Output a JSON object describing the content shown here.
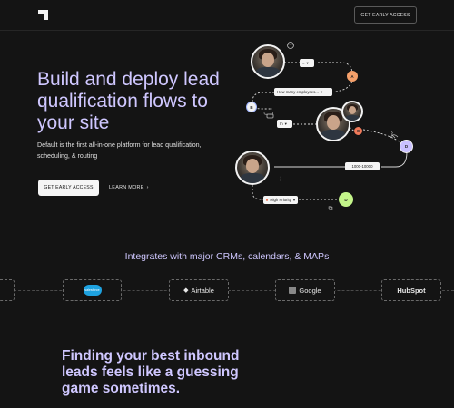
{
  "header": {
    "logo_icon": "default-logo-icon",
    "cta_label": "GET EARLY ACCESS"
  },
  "hero": {
    "title": "Build and deploy lead qualification flows to your site",
    "subtitle": "Default is the first all-in-one platform for lead qualification, scheduling, & routing",
    "primary_button": "GET EARLY ACCESS",
    "secondary_link": "LEARN MORE",
    "secondary_link_icon": "chevron-right-icon"
  },
  "flow": {
    "chip_equals": "= ",
    "chip_question": "How many employees...",
    "chip_in": "In",
    "chip_range": "1000-10000",
    "chip_priority": "High Priority",
    "node_a": "A",
    "node_c": "C",
    "node_d": "D",
    "node_b": "B",
    "accent_orange": "#f5a06a",
    "accent_purple": "#c9c0ff",
    "accent_green": "#c4f58a"
  },
  "integrations": {
    "heading": "Integrates with major CRMs, calendars, & MAPs",
    "logos": [
      "salesforce",
      "Airtable",
      "Google",
      "HubSpot"
    ]
  },
  "section2": {
    "title": "Finding your best inbound leads feels like a guessing game sometimes."
  }
}
